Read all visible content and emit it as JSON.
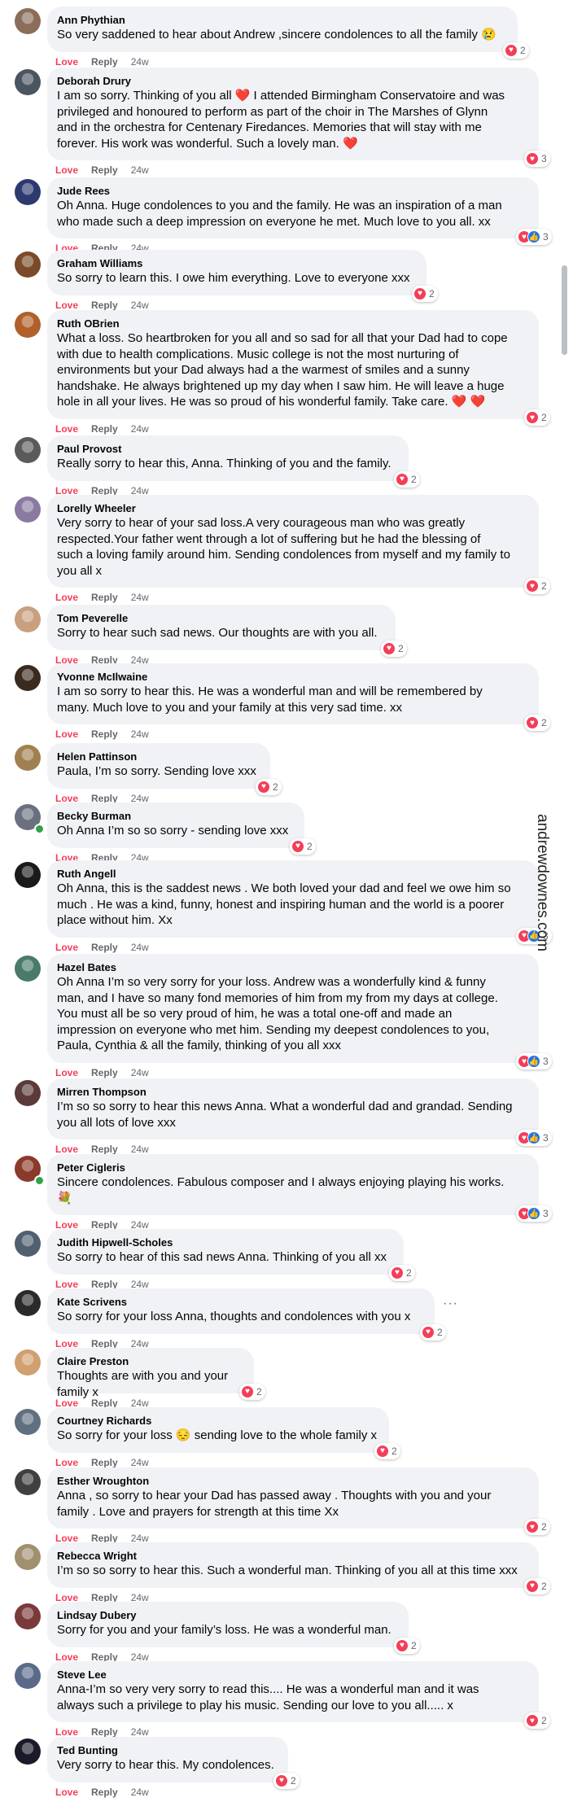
{
  "watermark": "andrewdownes.com",
  "action_labels": {
    "love": "Love",
    "reply": "Reply"
  },
  "comments": [
    {
      "name": "Ann Phythian",
      "lines": [
        "So very saddened to hear about Andrew ,sincere condolences to all the family 😢"
      ],
      "time": "24w",
      "reactions": {
        "types": [
          "heart"
        ],
        "count": "2"
      },
      "avatar_color": "#8a6e5a"
    },
    {
      "name": "Deborah Drury",
      "lines": [
        "I am so sorry. Thinking of you all ❤️ I attended Birmingham Conservatoire and was",
        "privileged and honoured to perform as part of the choir in The Marshes of Glynn",
        "and in the orchestra for Centenary Firedances. Memories that will stay with me",
        "forever. His work was wonderful. Such a lovely man. ❤️"
      ],
      "time": "24w",
      "reactions": {
        "types": [
          "heart"
        ],
        "count": "3"
      },
      "avatar_color": "#4a5560"
    },
    {
      "name": "Jude Rees",
      "lines": [
        "Oh Anna. Huge condolences to you and the family. He was an inspiration of a man",
        "who made such a deep impression on everyone he met. Much love to you all. xx"
      ],
      "time": "24w",
      "reactions": {
        "types": [
          "heart",
          "like"
        ],
        "count": "3"
      },
      "avatar_color": "#2c3a6e"
    },
    {
      "name": "Graham Williams",
      "lines": [
        "So sorry to learn this. I owe him everything. Love to everyone xxx"
      ],
      "time": "24w",
      "reactions": {
        "types": [
          "heart"
        ],
        "count": "2"
      },
      "avatar_color": "#7a4a2a"
    },
    {
      "name": "Ruth OBrien",
      "lines": [
        "What a loss. So heartbroken for you all and so sad for all that your Dad had to cope",
        "with due to health complications. Music college is not the most nurturing of",
        "environments but your Dad always had a the warmest of smiles and a sunny",
        "handshake. He always brightened up my day when I saw him. He will leave a huge",
        "hole in all your lives. He was so proud of his wonderful family. Take care. ❤️ ❤️"
      ],
      "time": "24w",
      "reactions": {
        "types": [
          "heart"
        ],
        "count": "2"
      },
      "avatar_color": "#b0602a"
    },
    {
      "name": "Paul Provost",
      "lines": [
        "Really sorry to hear this, Anna. Thinking of you and the family."
      ],
      "time": "24w",
      "reactions": {
        "types": [
          "heart"
        ],
        "count": "2"
      },
      "avatar_color": "#5a5a5a"
    },
    {
      "name": "Lorelly Wheeler",
      "lines": [
        "Very sorry to hear of your sad loss.A very courageous man who was greatly",
        "respected.Your father went through a lot of suffering but he had the blessing of",
        "such a loving family around him. Sending condolences from myself and my family to",
        "you all x"
      ],
      "time": "24w",
      "reactions": {
        "types": [
          "heart"
        ],
        "count": "2"
      },
      "avatar_color": "#8a7aa0"
    },
    {
      "name": "Tom Peverelle",
      "lines": [
        "Sorry to hear such sad news. Our thoughts are with you all."
      ],
      "time": "24w",
      "reactions": {
        "types": [
          "heart"
        ],
        "count": "2"
      },
      "avatar_color": "#c8a080"
    },
    {
      "name": "Yvonne McIlwaine",
      "lines": [
        "I am so sorry to hear this. He was a wonderful man and will be remembered by",
        "many. Much love to you and your family at this very sad time. xx"
      ],
      "time": "24w",
      "reactions": {
        "types": [
          "heart"
        ],
        "count": "2"
      },
      "avatar_color": "#3a2a20"
    },
    {
      "name": "Helen Pattinson",
      "lines": [
        "Paula, I’m so sorry. Sending love xxx"
      ],
      "time": "24w",
      "reactions": {
        "types": [
          "heart"
        ],
        "count": "2"
      },
      "avatar_color": "#a08050"
    },
    {
      "name": "Becky Burman",
      "lines": [
        "Oh Anna I’m so so sorry - sending love xxx"
      ],
      "time": "24w",
      "reactions": {
        "types": [
          "heart"
        ],
        "count": "2"
      },
      "avatar_color": "#6a7080",
      "online": true
    },
    {
      "name": "Ruth Angell",
      "lines": [
        "Oh Anna, this is the saddest news . We both loved your dad and feel we owe him so",
        "much . He was a kind, funny, honest and inspiring human and the world is a poorer",
        "place without him. Xx"
      ],
      "time": "24w",
      "reactions": {
        "types": [
          "heart",
          "like"
        ],
        "count": "3"
      },
      "avatar_color": "#1a1a1a"
    },
    {
      "name": "Hazel Bates",
      "lines": [
        "Oh Anna I’m so very sorry for your loss. Andrew was a wonderfully kind & funny",
        "man, and I have so many fond memories of him from my from my days at college.",
        "You must all be so very proud of him, he was a total one-off and made an",
        "impression on everyone who met him. Sending my deepest condolences to you,",
        "Paula, Cynthia & all the family, thinking of you all xxx"
      ],
      "time": "24w",
      "reactions": {
        "types": [
          "heart",
          "like"
        ],
        "count": "3"
      },
      "avatar_color": "#4a7a6a"
    },
    {
      "name": "Mirren Thompson",
      "lines": [
        "I’m so so sorry to hear this news Anna. What a wonderful dad and grandad. Sending",
        "you all lots of love xxx"
      ],
      "time": "24w",
      "reactions": {
        "types": [
          "heart",
          "like"
        ],
        "count": "3"
      },
      "avatar_color": "#5a3a3a"
    },
    {
      "name": "Peter Cigleris",
      "lines": [
        "Sincere condolences. Fabulous composer and I always enjoying playing his works.",
        "💐"
      ],
      "time": "24w",
      "reactions": {
        "types": [
          "heart",
          "like"
        ],
        "count": "3"
      },
      "avatar_color": "#8a3a2a",
      "online": true
    },
    {
      "name": "Judith Hipwell-Scholes",
      "lines": [
        "So sorry to hear of this sad news Anna. Thinking of you all xx"
      ],
      "time": "24w",
      "reactions": {
        "types": [
          "heart"
        ],
        "count": "2"
      },
      "avatar_color": "#506070"
    },
    {
      "name": "Kate Scrivens",
      "lines": [
        "So sorry for your loss Anna, thoughts and condolences with you x"
      ],
      "time": "24w",
      "reactions": {
        "types": [
          "heart"
        ],
        "count": "2"
      },
      "avatar_color": "#2a2a2a",
      "more": "···"
    },
    {
      "name": "Claire Preston",
      "lines": [
        "Thoughts are with you and your family x"
      ],
      "time": "24w",
      "reactions": {
        "types": [
          "heart"
        ],
        "count": "2"
      },
      "avatar_color": "#d0a070"
    },
    {
      "name": "Courtney Richards",
      "lines": [
        "So sorry for your loss 😔 sending love to the whole family x"
      ],
      "time": "24w",
      "reactions": {
        "types": [
          "heart"
        ],
        "count": "2"
      },
      "avatar_color": "#607080"
    },
    {
      "name": "Esther Wroughton",
      "lines": [
        "Anna , so sorry to hear your Dad has passed away . Thoughts with you and your",
        "family . Love and prayers for strength at this time Xx"
      ],
      "time": "24w",
      "reactions": {
        "types": [
          "heart"
        ],
        "count": "2"
      },
      "avatar_color": "#404040"
    },
    {
      "name": "Rebecca Wright",
      "lines": [
        "I’m so so sorry to hear this. Such a wonderful man. Thinking of you all at this time xxx"
      ],
      "time": "24w",
      "reactions": {
        "types": [
          "heart"
        ],
        "count": "2"
      },
      "avatar_color": "#a09070"
    },
    {
      "name": "Lindsay Dubery",
      "lines": [
        "Sorry for you and your family’s loss. He was a wonderful man."
      ],
      "time": "24w",
      "reactions": {
        "types": [
          "heart"
        ],
        "count": "2"
      },
      "avatar_color": "#7a3a3a"
    },
    {
      "name": "Steve Lee",
      "lines": [
        "Anna-I’m so very very sorry to read this.... He was a wonderful man and it was",
        "always such a privilege to play his music. Sending our love to you all..... x"
      ],
      "time": "24w",
      "reactions": {
        "types": [
          "heart"
        ],
        "count": "2"
      },
      "avatar_color": "#5a6a8a"
    },
    {
      "name": "Ted Bunting",
      "lines": [
        "Very sorry to hear this. My condolences."
      ],
      "time": "24w",
      "reactions": {
        "types": [
          "heart"
        ],
        "count": "2"
      },
      "avatar_color": "#1a1a2a"
    }
  ]
}
